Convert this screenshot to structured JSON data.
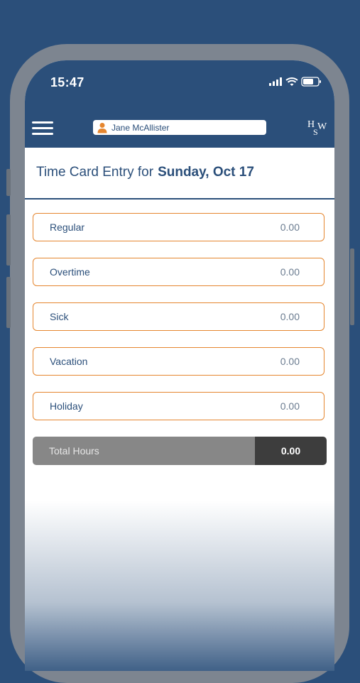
{
  "status_bar": {
    "time": "15:47",
    "icons": [
      "cellular-signal-icon",
      "wifi-icon",
      "battery-icon"
    ]
  },
  "header": {
    "menu_icon": "hamburger-menu-icon",
    "user_icon": "person-icon",
    "user_name": "Jane McAllister",
    "logo_text": "HSW"
  },
  "page": {
    "title_prefix": "Time Card Entry for",
    "title_date": "Sunday, Oct 17"
  },
  "entries": [
    {
      "label": "Regular",
      "value": "0.00"
    },
    {
      "label": "Overtime",
      "value": "0.00"
    },
    {
      "label": "Sick",
      "value": "0.00"
    },
    {
      "label": "Vacation",
      "value": "0.00"
    },
    {
      "label": "Holiday",
      "value": "0.00"
    }
  ],
  "total": {
    "label": "Total Hours",
    "value": "0.00"
  },
  "colors": {
    "brand_navy": "#2b4f7a",
    "accent_orange": "#e5862f",
    "total_label_bg": "#878787",
    "total_value_bg": "#3d3d3d"
  }
}
